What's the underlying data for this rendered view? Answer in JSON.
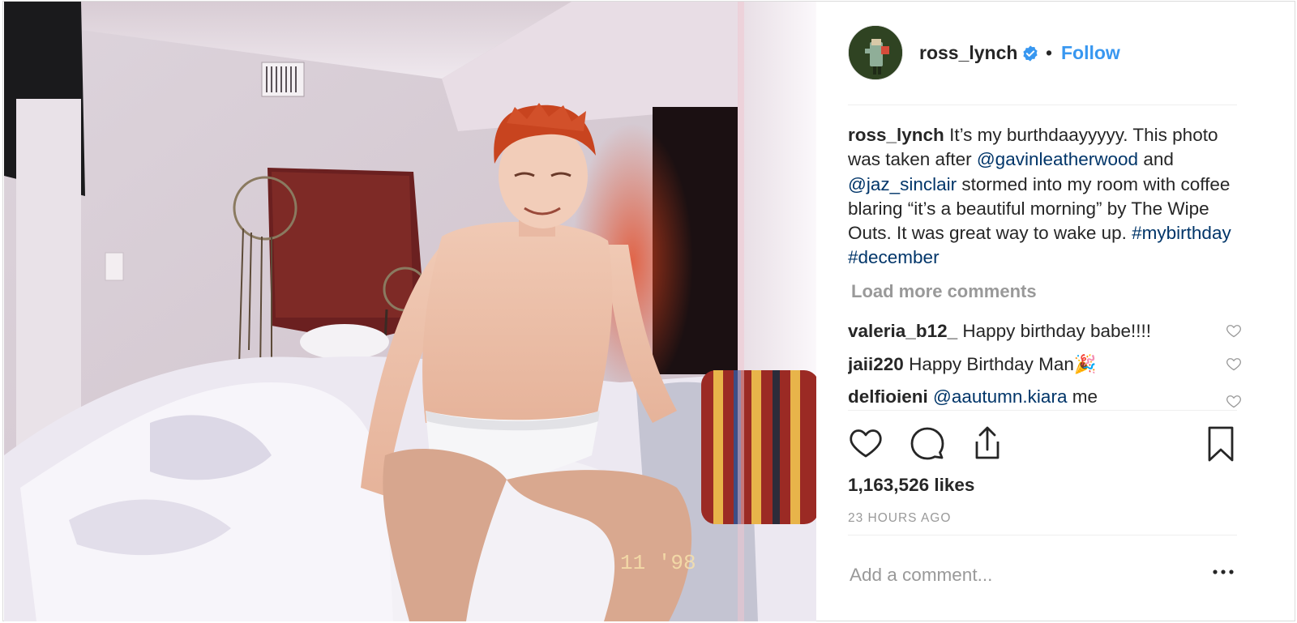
{
  "post": {
    "username": "ross_lynch",
    "follow_label": "Follow",
    "separator": "•",
    "caption": {
      "username": "ross_lynch",
      "text_1": " It’s my burthdaayyyyy. This photo was taken after ",
      "mention_1": "@gavinleatherwood",
      "text_2": " and ",
      "mention_2": "@jaz_sinclair",
      "text_3": " stormed into my room with coffee blaring “it’s a beautiful morning” by The Wipe Outs. It was great way to wake up. ",
      "hashtag_1": "#mybirthday",
      "hashtag_2": "#december"
    },
    "load_more_label": "Load more comments",
    "comments": [
      {
        "username": "valeria_b12_",
        "text": "Happy birthday babe!!!!"
      },
      {
        "username": "jaii220",
        "text": "Happy Birthday Man🎉"
      },
      {
        "username": "delfioieni",
        "mention": "@aautumn.kiara",
        "text": " me"
      }
    ],
    "likes": "1,163,526 likes",
    "timestamp": "23 HOURS AGO",
    "comment_placeholder": "Add a comment..."
  },
  "photo": {
    "timestamp_overlay": "11 '98"
  },
  "icons": {
    "verified": "verified-badge-icon",
    "like": "heart-icon",
    "comment": "speech-bubble-icon",
    "share": "share-icon",
    "save": "bookmark-icon",
    "more": "ellipsis-icon"
  },
  "colors": {
    "follow": "#3897f0",
    "link": "#003569",
    "muted": "#999999",
    "text": "#262626"
  }
}
